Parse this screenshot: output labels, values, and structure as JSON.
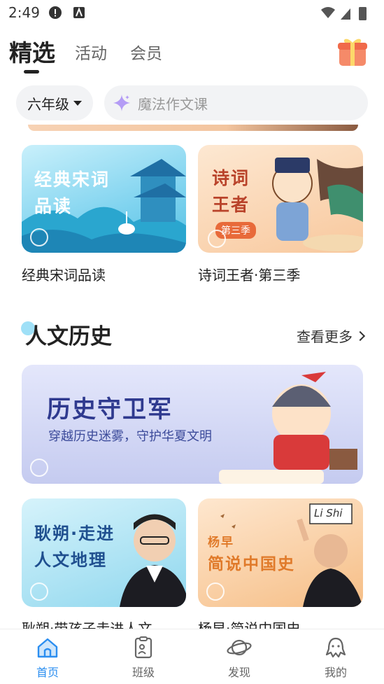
{
  "status_bar": {
    "time": "2:49"
  },
  "top_tabs": [
    {
      "label": "精选",
      "active": true
    },
    {
      "label": "活动",
      "active": false
    },
    {
      "label": "会员",
      "active": false
    }
  ],
  "filter": {
    "grade": "六年级",
    "search_placeholder": "魔法作文课"
  },
  "row1": [
    {
      "cover_text": [
        "经典宋词",
        "品读"
      ],
      "title": "经典宋词品读"
    },
    {
      "cover_text": [
        "诗词",
        "王者"
      ],
      "badge": "第三季",
      "title": "诗词王者·第三季"
    }
  ],
  "section": {
    "title": "人文历史",
    "more": "查看更多"
  },
  "banner": {
    "title": "历史守卫军",
    "subtitle": "穿越历史迷雾，守护华夏文明"
  },
  "row2": [
    {
      "cover_text": [
        "耿朔·走进",
        "人文地理"
      ],
      "title": "耿朔·带孩子走进人文"
    },
    {
      "cover_text": [
        "杨早",
        "简说中国史"
      ],
      "sign_text": "Li Shi",
      "title": "杨早·简说中国史"
    }
  ],
  "bottom_nav": [
    {
      "label": "首页",
      "icon": "home-icon",
      "active": true
    },
    {
      "label": "班级",
      "icon": "class-icon",
      "active": false
    },
    {
      "label": "发现",
      "icon": "planet-icon",
      "active": false
    },
    {
      "label": "我的",
      "icon": "octopus-icon",
      "active": false
    }
  ],
  "colors": {
    "accent": "#2b8ef0",
    "gift": "#f06a4a"
  }
}
